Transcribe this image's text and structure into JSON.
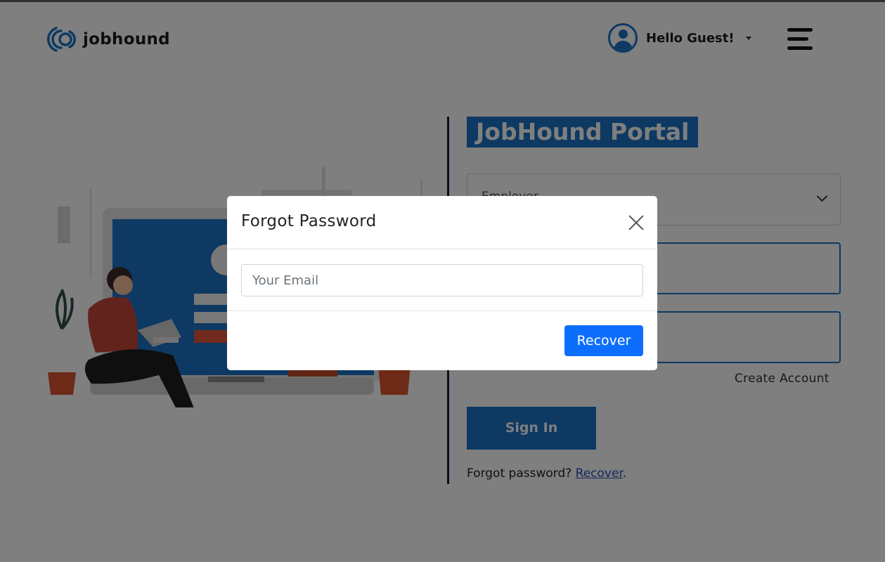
{
  "header": {
    "brand_name": "jobhound",
    "user_greeting": "Hello Guest!",
    "icons": {
      "logo": "jobhound-logo-icon",
      "avatar": "user-avatar-icon",
      "menu": "hamburger-menu-icon"
    }
  },
  "login": {
    "portal_title": "JobHound Portal",
    "role_select_value": "Employer",
    "create_account_label": "Create Account",
    "sign_in_label": "Sign In",
    "forgot_prompt": "Forgot password?",
    "forgot_link": "Recover"
  },
  "modal": {
    "title": "Forgot Password",
    "email_placeholder": "Your Email",
    "submit_label": "Recover"
  },
  "colors": {
    "brand_blue": "#1a73c7",
    "button_primary": "#0d6efd",
    "divider_navy": "#0d1b4a",
    "overlay": "rgba(0,0,0,0.5)"
  }
}
